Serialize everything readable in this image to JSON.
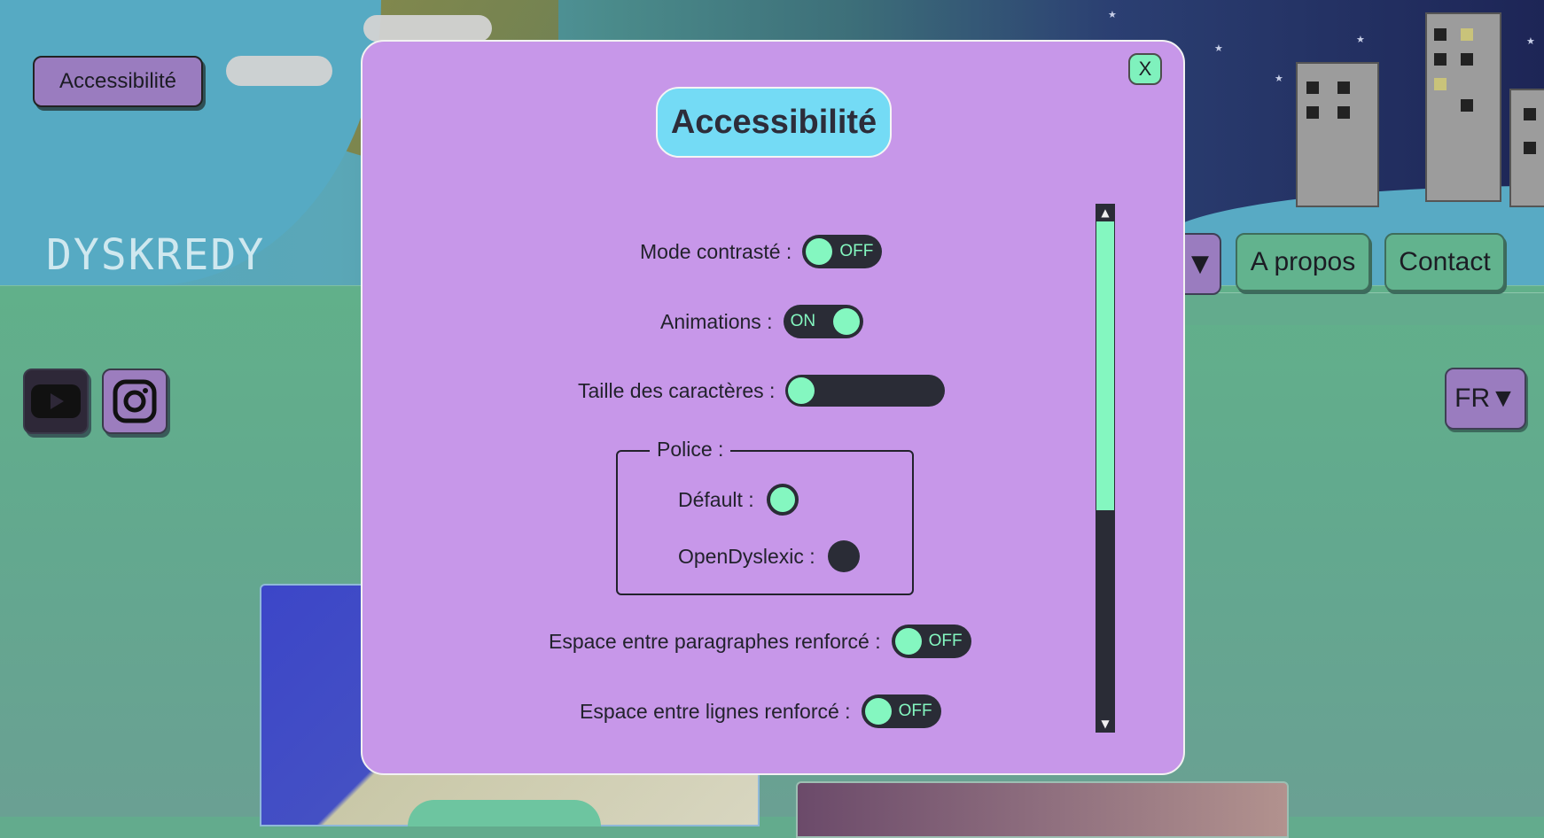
{
  "header": {
    "accessibility_button": "Accessibilité",
    "logo": "DYSKREDY"
  },
  "nav": {
    "about": "A propos",
    "contact": "Contact",
    "dropdown_arrow": "▼",
    "language": "FR▼"
  },
  "social": {
    "youtube_icon": "youtube-icon",
    "instagram_icon": "instagram-icon"
  },
  "modal": {
    "close_label": "X",
    "title": "Accessibilité",
    "contrast_mode": {
      "label": "Mode contrasté :",
      "state": "OFF"
    },
    "animations": {
      "label": "Animations :",
      "state": "ON"
    },
    "font_size": {
      "label": "Taille des caractères :",
      "level": 0
    },
    "font": {
      "legend": "Police :",
      "default_label": "Défault :",
      "opendyslexic_label": "OpenDyslexic :",
      "selected": "default"
    },
    "paragraph_spacing": {
      "label": "Espace entre paragraphes renforcé :",
      "state": "OFF"
    },
    "line_spacing": {
      "label": "Espace entre lignes renforcé :",
      "state": "OFF"
    }
  },
  "colors": {
    "modal_bg": "#c797e9",
    "title_bg": "#74dbf5",
    "accent_green": "#84f7c0",
    "dark": "#2a2c36",
    "nav_green": "#62b38e",
    "purple_button": "#9a7cbf"
  }
}
